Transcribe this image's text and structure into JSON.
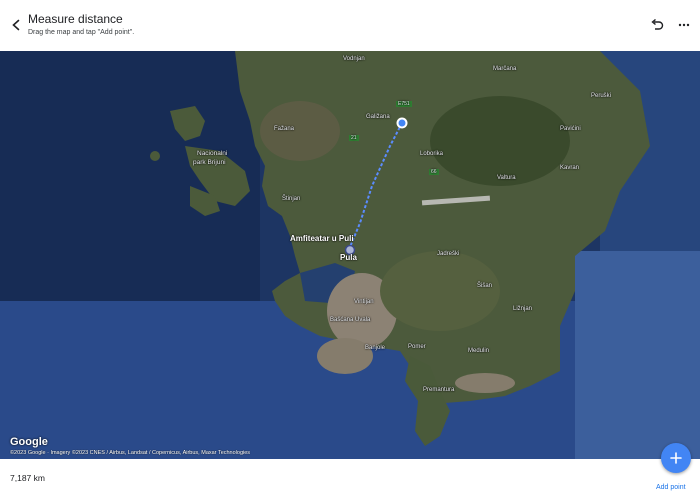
{
  "header": {
    "title": "Measure distance",
    "subtitle": "Drag the map and tap \"Add point\"."
  },
  "map": {
    "places": [
      {
        "name": "Vodnjan"
      },
      {
        "name": "Marčana"
      },
      {
        "name": "Peruški"
      },
      {
        "name": "Fažana"
      },
      {
        "name": "Galižana"
      },
      {
        "name": "Pavićini"
      },
      {
        "name": "Nacionalni"
      },
      {
        "name": "park Brijuni"
      },
      {
        "name": "Loborika"
      },
      {
        "name": "Kavran"
      },
      {
        "name": "Valtura"
      },
      {
        "name": "Štinjan"
      },
      {
        "name": "Amfiteatar u Puli"
      },
      {
        "name": "Pula"
      },
      {
        "name": "Jadreški"
      },
      {
        "name": "Šišan"
      },
      {
        "name": "Vintijan"
      },
      {
        "name": "Ližnjan"
      },
      {
        "name": "Bašćana Uvala"
      },
      {
        "name": "Banjole"
      },
      {
        "name": "Pomer"
      },
      {
        "name": "Medulin"
      },
      {
        "name": "Premantura"
      }
    ],
    "road_labels": [
      "E751",
      "21",
      "66"
    ],
    "logo": "Google",
    "attribution": "©2023 Google · Imagery ©2023 CNES / Airbus, Landsat / Copernicus, Airbus, Maxar Technologies"
  },
  "footer": {
    "distance": "7,187 km",
    "add_point_label": "Add point"
  },
  "colors": {
    "accent": "#1a73e8",
    "fab": "#4285f4",
    "sea": "#1d3563",
    "land": "#4c5a3c"
  }
}
